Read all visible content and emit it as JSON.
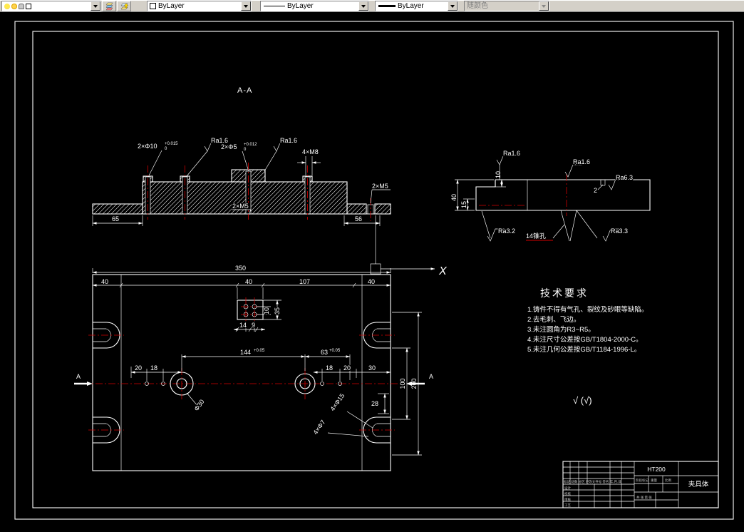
{
  "toolbar": {
    "color_value": "ByLayer",
    "linetype_value": "ByLayer",
    "lineweight_value": "ByLayer",
    "plotstyle_value": "随颜色"
  },
  "section_view": {
    "label": "A-A",
    "dims": {
      "d2x10": "2×Φ10",
      "tol10_u": "+0.015",
      "tol10_d": "0",
      "ra16_left": "Ra1.6",
      "d2x5": "2×Φ5",
      "tol5_u": "+0.012",
      "tol5_d": "0",
      "ra16_right": "Ra1.6",
      "d4xm8": "4×M8",
      "d2xm5_mid": "2×M5",
      "d2xm5_right": "2×M5",
      "d65": "65",
      "d56": "56"
    }
  },
  "side_view": {
    "dims": {
      "ra16_a": "Ra1.6",
      "ra16_b": "Ra1.6",
      "ra63": "Ra6.3",
      "ra32": "Ra3.2",
      "ra33": "Ra3.3",
      "d40": "40",
      "d15": "15",
      "d10": "10",
      "d2": "2",
      "taper_hole": "14锥孔"
    }
  },
  "plan_view": {
    "axis_x": "X",
    "section_marker_left": "A",
    "section_marker_right": "A",
    "dims": {
      "d350": "350",
      "d40_left": "40",
      "d40_mid": "40",
      "d107": "107",
      "d40_right": "40",
      "d14": "14",
      "d9": "9",
      "d10": "10",
      "d35": "35",
      "d144": "144",
      "d144_tol": "+0.05",
      "d63": "63",
      "d63_tol": "+0.05",
      "d20_left": "20",
      "d18_left": "18",
      "d18_right": "18",
      "d20_right": "20",
      "d30": "30",
      "d100": "100",
      "d200": "200",
      "d28": "28",
      "dia30": "Φ30",
      "d4x15": "4×Φ15",
      "d4x7": "4×Φ7"
    }
  },
  "tech_req": {
    "title": "技术要求",
    "items": [
      "1.铸件不得有气孔、裂纹及砂眼等缺陷。",
      "2.去毛刺、飞边。",
      "3.未注圆角为R3~R5。",
      "4.未注尺寸公差按GB/T1804-2000-C。",
      "5.未注几何公差按GB/T1184-1996-L。"
    ],
    "finish_note": "√ (√)"
  },
  "title_block": {
    "material": "HT200",
    "part_name": "夹具体",
    "rev_header": "标记 处数 分区 更改文件号 签名 年.月.日",
    "rows": [
      "设计",
      "校核",
      "审核",
      "工艺"
    ],
    "stage": "阶段标记",
    "weight": "重量",
    "scale": "比例",
    "sheets": "共 张  第 张"
  }
}
